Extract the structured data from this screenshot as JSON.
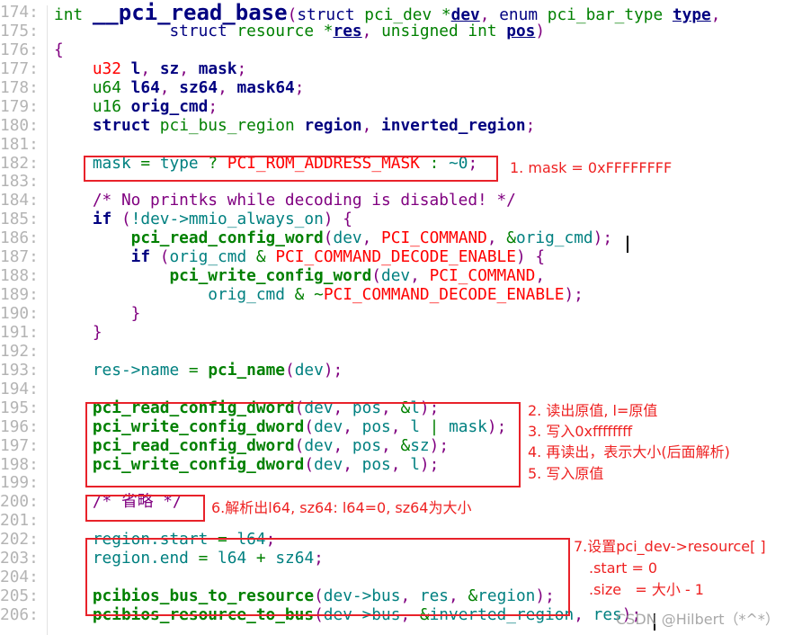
{
  "colors": {
    "annotation": "#e8222a",
    "keyword": "#000080",
    "type": "#008000",
    "identifier": "#008080",
    "punct": "#800080",
    "constant": "#ff0000",
    "line_number": "#b4b4b4"
  },
  "code": {
    "lines": [
      {
        "n": "174:",
        "tokens": [
          [
            "t",
            "int"
          ],
          [
            "s",
            " "
          ],
          [
            "f",
            "__pci_read_base"
          ],
          [
            "p",
            "("
          ],
          [
            "k",
            "struct"
          ],
          [
            "s",
            " "
          ],
          [
            "t",
            "pci_dev"
          ],
          [
            "s",
            " "
          ],
          [
            "o",
            "*"
          ],
          [
            "vu",
            "dev"
          ],
          [
            "p",
            ","
          ],
          [
            "s",
            " "
          ],
          [
            "k",
            "enum"
          ],
          [
            "s",
            " "
          ],
          [
            "t",
            "pci_bar_type"
          ],
          [
            "s",
            " "
          ],
          [
            "vu",
            "type"
          ],
          [
            "p",
            ","
          ]
        ]
      },
      {
        "n": "175:",
        "tokens": [
          [
            "s",
            "            "
          ],
          [
            "k",
            "struct"
          ],
          [
            "s",
            " "
          ],
          [
            "t",
            "resource"
          ],
          [
            "s",
            " "
          ],
          [
            "o",
            "*"
          ],
          [
            "vu",
            "res"
          ],
          [
            "p",
            ","
          ],
          [
            "s",
            " "
          ],
          [
            "t",
            "unsigned int"
          ],
          [
            "s",
            " "
          ],
          [
            "vu",
            "pos"
          ],
          [
            "p",
            ")"
          ]
        ]
      },
      {
        "n": "176:",
        "tokens": [
          [
            "p",
            "{"
          ]
        ]
      },
      {
        "n": "177:",
        "tokens": [
          [
            "s",
            "    "
          ],
          [
            "r",
            "u32"
          ],
          [
            "s",
            " "
          ],
          [
            "v",
            "l"
          ],
          [
            "p",
            ","
          ],
          [
            "s",
            " "
          ],
          [
            "v",
            "sz"
          ],
          [
            "p",
            ","
          ],
          [
            "s",
            " "
          ],
          [
            "v",
            "mask"
          ],
          [
            "p",
            ";"
          ]
        ]
      },
      {
        "n": "178:",
        "tokens": [
          [
            "s",
            "    "
          ],
          [
            "t",
            "u64"
          ],
          [
            "s",
            " "
          ],
          [
            "v",
            "l64"
          ],
          [
            "p",
            ","
          ],
          [
            "s",
            " "
          ],
          [
            "v",
            "sz64"
          ],
          [
            "p",
            ","
          ],
          [
            "s",
            " "
          ],
          [
            "v",
            "mask64"
          ],
          [
            "p",
            ";"
          ]
        ]
      },
      {
        "n": "179:",
        "tokens": [
          [
            "s",
            "    "
          ],
          [
            "t",
            "u16"
          ],
          [
            "s",
            " "
          ],
          [
            "v",
            "orig_cmd"
          ],
          [
            "p",
            ";"
          ]
        ]
      },
      {
        "n": "180:",
        "tokens": [
          [
            "s",
            "    "
          ],
          [
            "kb",
            "struct"
          ],
          [
            "s",
            " "
          ],
          [
            "t",
            "pci_bus_region"
          ],
          [
            "s",
            " "
          ],
          [
            "v",
            "region"
          ],
          [
            "p",
            ","
          ],
          [
            "s",
            " "
          ],
          [
            "v",
            "inverted_region"
          ],
          [
            "p",
            ";"
          ]
        ]
      },
      {
        "n": "181:",
        "tokens": []
      },
      {
        "n": "182:",
        "tokens": [
          [
            "s",
            "    "
          ],
          [
            "i",
            "mask"
          ],
          [
            "s",
            " "
          ],
          [
            "o",
            "="
          ],
          [
            "s",
            " "
          ],
          [
            "i",
            "type"
          ],
          [
            "s",
            " "
          ],
          [
            "o",
            "?"
          ],
          [
            "s",
            " "
          ],
          [
            "r",
            "PCI_ROM_ADDRESS_MASK"
          ],
          [
            "s",
            " "
          ],
          [
            "o",
            ":"
          ],
          [
            "s",
            " "
          ],
          [
            "i",
            "~0"
          ],
          [
            "p",
            ";"
          ]
        ]
      },
      {
        "n": "183:",
        "tokens": []
      },
      {
        "n": "184:",
        "tokens": [
          [
            "s",
            "    "
          ],
          [
            "c",
            "/* No printks while decoding is disabled! */"
          ]
        ]
      },
      {
        "n": "185:",
        "tokens": [
          [
            "s",
            "    "
          ],
          [
            "kb",
            "if"
          ],
          [
            "s",
            " "
          ],
          [
            "p",
            "("
          ],
          [
            "i",
            "!dev->mmio_always_on"
          ],
          [
            "p",
            ")"
          ],
          [
            "s",
            " "
          ],
          [
            "p",
            "{"
          ]
        ]
      },
      {
        "n": "186:",
        "tokens": [
          [
            "s",
            "        "
          ],
          [
            "call",
            "pci_read_config_word"
          ],
          [
            "p",
            "("
          ],
          [
            "i",
            "dev"
          ],
          [
            "p",
            ","
          ],
          [
            "s",
            " "
          ],
          [
            "r",
            "PCI_COMMAND"
          ],
          [
            "p",
            ","
          ],
          [
            "s",
            " "
          ],
          [
            "o",
            "&"
          ],
          [
            "i",
            "orig_cmd"
          ],
          [
            "p",
            ");"
          ]
        ]
      },
      {
        "n": "187:",
        "tokens": [
          [
            "s",
            "        "
          ],
          [
            "kb",
            "if"
          ],
          [
            "s",
            " "
          ],
          [
            "p",
            "("
          ],
          [
            "i",
            "orig_cmd"
          ],
          [
            "s",
            " "
          ],
          [
            "o",
            "&"
          ],
          [
            "s",
            " "
          ],
          [
            "r",
            "PCI_COMMAND_DECODE_ENABLE"
          ],
          [
            "p",
            ")"
          ],
          [
            "s",
            " "
          ],
          [
            "p",
            "{"
          ]
        ]
      },
      {
        "n": "188:",
        "tokens": [
          [
            "s",
            "            "
          ],
          [
            "call",
            "pci_write_config_word"
          ],
          [
            "p",
            "("
          ],
          [
            "i",
            "dev"
          ],
          [
            "p",
            ","
          ],
          [
            "s",
            " "
          ],
          [
            "r",
            "PCI_COMMAND"
          ],
          [
            "p",
            ","
          ]
        ]
      },
      {
        "n": "189:",
        "tokens": [
          [
            "s",
            "                "
          ],
          [
            "i",
            "orig_cmd"
          ],
          [
            "s",
            " "
          ],
          [
            "o",
            "&"
          ],
          [
            "s",
            " "
          ],
          [
            "o",
            "~"
          ],
          [
            "r",
            "PCI_COMMAND_DECODE_ENABLE"
          ],
          [
            "p",
            ");"
          ]
        ]
      },
      {
        "n": "190:",
        "tokens": [
          [
            "s",
            "        "
          ],
          [
            "p",
            "}"
          ]
        ]
      },
      {
        "n": "191:",
        "tokens": [
          [
            "s",
            "    "
          ],
          [
            "p",
            "}"
          ]
        ]
      },
      {
        "n": "192:",
        "tokens": []
      },
      {
        "n": "193:",
        "tokens": [
          [
            "s",
            "    "
          ],
          [
            "i",
            "res->name"
          ],
          [
            "s",
            " "
          ],
          [
            "o",
            "="
          ],
          [
            "s",
            " "
          ],
          [
            "call",
            "pci_name"
          ],
          [
            "p",
            "("
          ],
          [
            "i",
            "dev"
          ],
          [
            "p",
            ");"
          ]
        ]
      },
      {
        "n": "194:",
        "tokens": []
      },
      {
        "n": "195:",
        "tokens": [
          [
            "s",
            "    "
          ],
          [
            "call",
            "pci_read_config_dword"
          ],
          [
            "p",
            "("
          ],
          [
            "i",
            "dev"
          ],
          [
            "p",
            ","
          ],
          [
            "s",
            " "
          ],
          [
            "i",
            "pos"
          ],
          [
            "p",
            ","
          ],
          [
            "s",
            " "
          ],
          [
            "o",
            "&"
          ],
          [
            "i",
            "l"
          ],
          [
            "p",
            ");"
          ]
        ]
      },
      {
        "n": "196:",
        "tokens": [
          [
            "s",
            "    "
          ],
          [
            "call",
            "pci_write_config_dword"
          ],
          [
            "p",
            "("
          ],
          [
            "i",
            "dev"
          ],
          [
            "p",
            ","
          ],
          [
            "s",
            " "
          ],
          [
            "i",
            "pos"
          ],
          [
            "p",
            ","
          ],
          [
            "s",
            " "
          ],
          [
            "i",
            "l"
          ],
          [
            "s",
            " "
          ],
          [
            "o",
            "|"
          ],
          [
            "s",
            " "
          ],
          [
            "i",
            "mask"
          ],
          [
            "p",
            ");"
          ]
        ]
      },
      {
        "n": "197:",
        "tokens": [
          [
            "s",
            "    "
          ],
          [
            "call",
            "pci_read_config_dword"
          ],
          [
            "p",
            "("
          ],
          [
            "i",
            "dev"
          ],
          [
            "p",
            ","
          ],
          [
            "s",
            " "
          ],
          [
            "i",
            "pos"
          ],
          [
            "p",
            ","
          ],
          [
            "s",
            " "
          ],
          [
            "o",
            "&"
          ],
          [
            "i",
            "sz"
          ],
          [
            "p",
            ");"
          ]
        ]
      },
      {
        "n": "198:",
        "tokens": [
          [
            "s",
            "    "
          ],
          [
            "call",
            "pci_write_config_dword"
          ],
          [
            "p",
            "("
          ],
          [
            "i",
            "dev"
          ],
          [
            "p",
            ","
          ],
          [
            "s",
            " "
          ],
          [
            "i",
            "pos"
          ],
          [
            "p",
            ","
          ],
          [
            "s",
            " "
          ],
          [
            "i",
            "l"
          ],
          [
            "p",
            ");"
          ]
        ]
      },
      {
        "n": "199:",
        "tokens": []
      },
      {
        "n": "200:",
        "tokens": [
          [
            "s",
            "    "
          ],
          [
            "c",
            "/* 省略 */"
          ]
        ]
      },
      {
        "n": "201:",
        "tokens": []
      },
      {
        "n": "202:",
        "tokens": [
          [
            "s",
            "    "
          ],
          [
            "i",
            "region.start"
          ],
          [
            "s",
            " "
          ],
          [
            "o",
            "="
          ],
          [
            "s",
            " "
          ],
          [
            "i",
            "l64"
          ],
          [
            "p",
            ";"
          ]
        ]
      },
      {
        "n": "203:",
        "tokens": [
          [
            "s",
            "    "
          ],
          [
            "i",
            "region.end"
          ],
          [
            "s",
            " "
          ],
          [
            "o",
            "="
          ],
          [
            "s",
            " "
          ],
          [
            "i",
            "l64"
          ],
          [
            "s",
            " "
          ],
          [
            "o",
            "+"
          ],
          [
            "s",
            " "
          ],
          [
            "i",
            "sz64"
          ],
          [
            "p",
            ";"
          ]
        ]
      },
      {
        "n": "204:",
        "tokens": []
      },
      {
        "n": "205:",
        "tokens": [
          [
            "s",
            "    "
          ],
          [
            "call",
            "pcibios_bus_to_resource"
          ],
          [
            "p",
            "("
          ],
          [
            "i",
            "dev->bus"
          ],
          [
            "p",
            ","
          ],
          [
            "s",
            " "
          ],
          [
            "i",
            "res"
          ],
          [
            "p",
            ","
          ],
          [
            "s",
            " "
          ],
          [
            "o",
            "&"
          ],
          [
            "i",
            "region"
          ],
          [
            "p",
            ");"
          ]
        ]
      },
      {
        "n": "206:",
        "tokens": [
          [
            "s",
            "    "
          ],
          [
            "call",
            "pcibios_resource_to_bus"
          ],
          [
            "p",
            "("
          ],
          [
            "i",
            "dev->bus"
          ],
          [
            "p",
            ","
          ],
          [
            "s",
            " "
          ],
          [
            "o",
            "&"
          ],
          [
            "i",
            "inverted_region"
          ],
          [
            "p",
            ","
          ],
          [
            "s",
            " "
          ],
          [
            "i",
            "res"
          ],
          [
            "p",
            ");"
          ]
        ]
      }
    ]
  },
  "annotations": {
    "note1": "1. mask = 0xFFFFFFFF",
    "note2": "2. 读出原值, l=原值",
    "note3": "3. 写入0xffffffff",
    "note4": "4. 再读出，表示大小(后面解析)",
    "note5": "5. 写入原值",
    "note6": "6.解析出l64, sz64: l64=0, sz64为大小",
    "note7": "7.设置pci_dev->resource[ ]",
    "note7_start": ".start = 0",
    "note7_size": ".size   = 大小 - 1"
  },
  "watermark": "CSDN @Hilbert（*^*）"
}
